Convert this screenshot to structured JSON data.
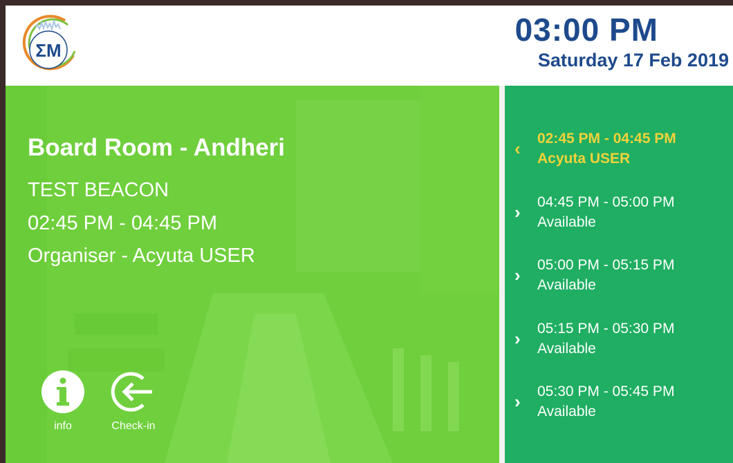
{
  "header": {
    "logo_text": "ΣM",
    "time": "03:00 PM",
    "date": "Saturday 17 Feb 2019"
  },
  "room": {
    "name": "Board Room - Andheri",
    "meeting_title": "TEST BEACON",
    "meeting_time": "02:45 PM - 04:45 PM",
    "organiser": "Organiser - Acyuta USER"
  },
  "actions": {
    "info_label": "info",
    "checkin_label": "Check-in"
  },
  "schedule": {
    "slots": [
      {
        "range": "02:45 PM - 04:45 PM",
        "status": "Acyuta USER",
        "chevron": "‹"
      },
      {
        "range": "04:45 PM - 05:00 PM",
        "status": "Available",
        "chevron": "›"
      },
      {
        "range": "05:00 PM - 05:15 PM",
        "status": "Available",
        "chevron": "›"
      },
      {
        "range": "05:15 PM - 05:30 PM",
        "status": "Available",
        "chevron": "›"
      },
      {
        "range": "05:30 PM - 05:45 PM",
        "status": "Available",
        "chevron": "›"
      }
    ]
  },
  "colors": {
    "accent_blue": "#1e4a8c",
    "main_green": "#6fcf3c",
    "schedule_green": "#1fae62",
    "current_highlight": "#f2d23a"
  }
}
